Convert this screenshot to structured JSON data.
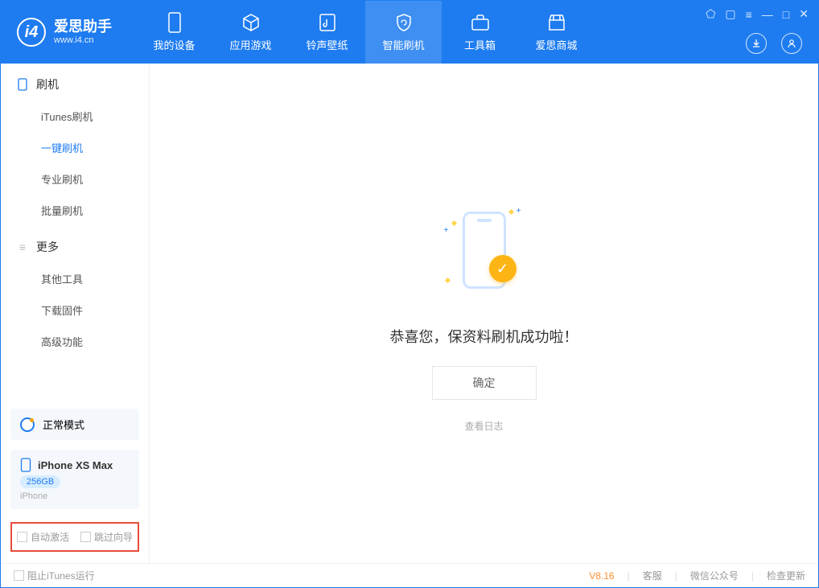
{
  "app": {
    "title": "爱思助手",
    "subtitle": "www.i4.cn"
  },
  "nav": {
    "tabs": [
      {
        "label": "我的设备"
      },
      {
        "label": "应用游戏"
      },
      {
        "label": "铃声壁纸"
      },
      {
        "label": "智能刷机"
      },
      {
        "label": "工具箱"
      },
      {
        "label": "爱思商城"
      }
    ],
    "active_index": 3
  },
  "sidebar": {
    "group_flash": {
      "title": "刷机",
      "items": [
        "iTunes刷机",
        "一键刷机",
        "专业刷机",
        "批量刷机"
      ]
    },
    "group_more": {
      "title": "更多",
      "items": [
        "其他工具",
        "下载固件",
        "高级功能"
      ]
    },
    "active_item": "一键刷机"
  },
  "mode": {
    "label": "正常模式"
  },
  "device": {
    "name": "iPhone XS Max",
    "storage": "256GB",
    "type": "iPhone"
  },
  "options": {
    "auto_activate": "自动激活",
    "skip_wizard": "跳过向导"
  },
  "main": {
    "success_title": "恭喜您，保资料刷机成功啦！",
    "confirm_label": "确定",
    "view_log_label": "查看日志"
  },
  "footer": {
    "block_itunes": "阻止iTunes运行",
    "version": "V8.16",
    "links": [
      "客服",
      "微信公众号",
      "检查更新"
    ]
  }
}
